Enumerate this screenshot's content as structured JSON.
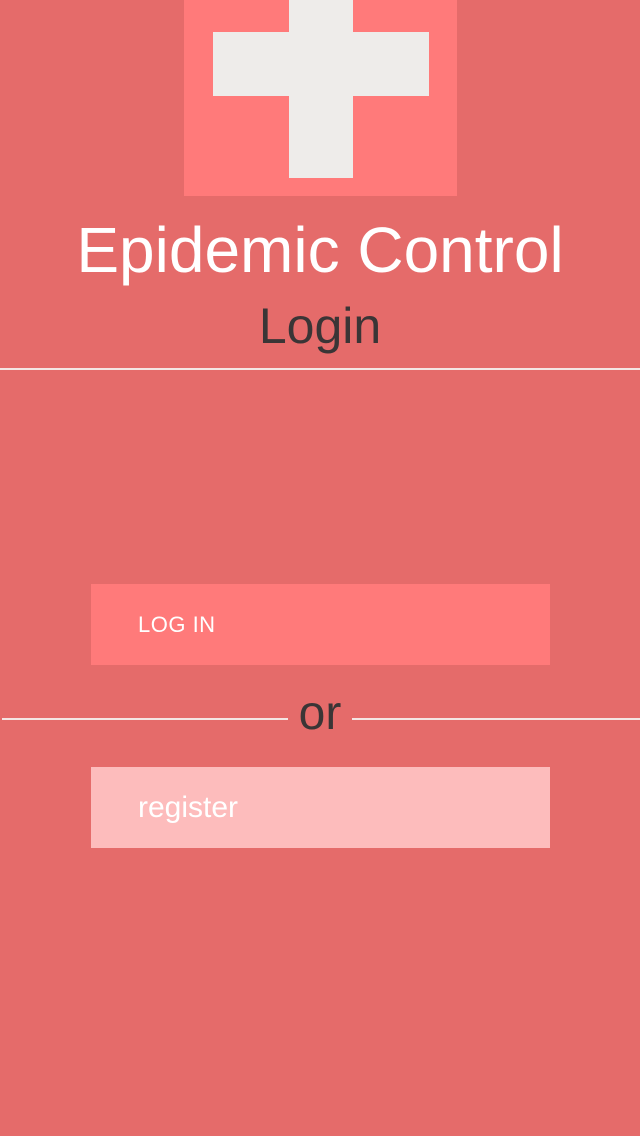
{
  "app": {
    "title": "Epidemic Control",
    "page_title": "Login"
  },
  "logo": {
    "icon": "medical-cross-icon",
    "background_color": "#FF7A7A",
    "cross_color": "#EEECEA"
  },
  "actions": {
    "login_label": "LOG IN",
    "separator_text": "or",
    "register_label": "register"
  },
  "colors": {
    "background": "#E56B6A",
    "login_button": "#FF7A7A",
    "register_button": "#FDBCBC",
    "dark_text": "#3A3536",
    "divider": "#F4E6E4"
  }
}
